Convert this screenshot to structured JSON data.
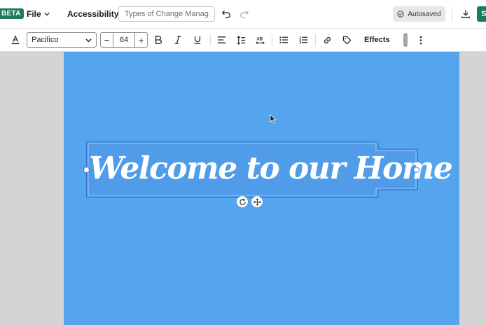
{
  "topbar": {
    "beta_label": "BETA",
    "file_label": "File",
    "accessibility_label": "Accessibility",
    "title_placeholder": "Types of Change Manag...",
    "autosaved_label": "Autosaved",
    "share_label": "S"
  },
  "format": {
    "font_family": "Pacifico",
    "font_size": "64",
    "minus": "−",
    "plus": "+",
    "effects_label": "Effects"
  },
  "canvas": {
    "page_color": "#55a4ee",
    "headline": "Welcome to our Home"
  },
  "colors": {
    "accent": "#1f7a5c",
    "selection": "#3a7bd5"
  }
}
